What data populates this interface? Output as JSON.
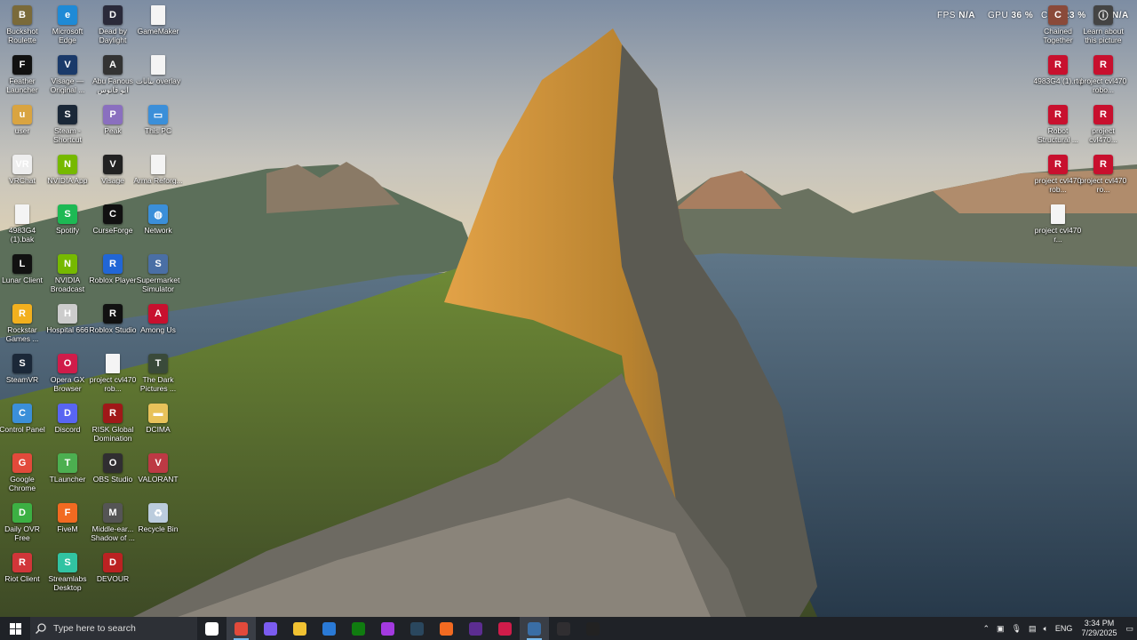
{
  "overlay": {
    "fps_label": "FPS",
    "fps_value": "N/A",
    "gpu_label": "GPU",
    "gpu_value": "36 %",
    "cpu_label": "CPU",
    "cpu_value": "23 %",
    "extra_value": "N/A"
  },
  "desktop_icons_left": [
    {
      "label": "Buckshot Roulette",
      "color": "#7a6a3a",
      "glyph": "B"
    },
    {
      "label": "Microsoft Edge",
      "color": "#1f8ad6",
      "glyph": "e"
    },
    {
      "label": "Dead by Daylight",
      "color": "#2a2a3a",
      "glyph": "D"
    },
    {
      "label": "GameMaker",
      "color": "file",
      "glyph": ""
    },
    {
      "label": "Feather Launcher",
      "color": "#111",
      "glyph": "F"
    },
    {
      "label": "Visage — Original ...",
      "color": "#1a3a6a",
      "glyph": "V"
    },
    {
      "label": "Abu Fanous ابو فانوس",
      "color": "#333",
      "glyph": "A"
    },
    {
      "label": "بيانات overlay",
      "color": "file",
      "glyph": ""
    },
    {
      "label": "user",
      "color": "#d9a441",
      "glyph": "u"
    },
    {
      "label": "Steam - Shortcut",
      "color": "#1b2838",
      "glyph": "S"
    },
    {
      "label": "Peak",
      "color": "#8a6fbf",
      "glyph": "P"
    },
    {
      "label": "This PC",
      "color": "#3b8fd9",
      "glyph": "▭"
    },
    {
      "label": "VRChat",
      "color": "#eee",
      "glyph": "VR"
    },
    {
      "label": "NVIDIA App",
      "color": "#76b900",
      "glyph": "N"
    },
    {
      "label": "Visage",
      "color": "#222",
      "glyph": "V"
    },
    {
      "label": "Arma Reforg...",
      "color": "file",
      "glyph": ""
    },
    {
      "label": "4983G4 (1).bak",
      "color": "file",
      "glyph": ""
    },
    {
      "label": "Spotify",
      "color": "#1db954",
      "glyph": "S"
    },
    {
      "label": "CurseForge",
      "color": "#111",
      "glyph": "C"
    },
    {
      "label": "Network",
      "color": "#3b8fd9",
      "glyph": "◍"
    },
    {
      "label": "Lunar Client",
      "color": "#111",
      "glyph": "L"
    },
    {
      "label": "NVIDIA Broadcast",
      "color": "#76b900",
      "glyph": "N"
    },
    {
      "label": "Roblox Player",
      "color": "#2166d6",
      "glyph": "R"
    },
    {
      "label": "Supermarket Simulator",
      "color": "#4a6fa5",
      "glyph": "S"
    },
    {
      "label": "Rockstar Games ...",
      "color": "#f2b01e",
      "glyph": "R"
    },
    {
      "label": "Hospital 666",
      "color": "#ccc",
      "glyph": "H"
    },
    {
      "label": "Roblox Studio",
      "color": "#111",
      "glyph": "R"
    },
    {
      "label": "Among Us",
      "color": "#c8102e",
      "glyph": "A"
    },
    {
      "label": "SteamVR",
      "color": "#1b2838",
      "glyph": "S"
    },
    {
      "label": "Opera GX Browser",
      "color": "#d01c4a",
      "glyph": "O"
    },
    {
      "label": "project cvl470 rob...",
      "color": "file",
      "glyph": ""
    },
    {
      "label": "The Dark Pictures ...",
      "color": "#3a4a3a",
      "glyph": "T"
    },
    {
      "label": "Control Panel",
      "color": "#3b8fd9",
      "glyph": "C"
    },
    {
      "label": "Discord",
      "color": "#5865f2",
      "glyph": "D"
    },
    {
      "label": "RISK Global Domination",
      "color": "#a01818",
      "glyph": "R"
    },
    {
      "label": "DCIMA",
      "color": "#e8c25a",
      "glyph": "▬"
    },
    {
      "label": "Google Chrome",
      "color": "#e24a3b",
      "glyph": "G"
    },
    {
      "label": "TLauncher",
      "color": "#4caf50",
      "glyph": "T"
    },
    {
      "label": "OBS Studio",
      "color": "#302e31",
      "glyph": "O"
    },
    {
      "label": "VALORANT",
      "color": "#bd3944",
      "glyph": "V"
    },
    {
      "label": "Daily OVR Free",
      "color": "#3cb043",
      "glyph": "D"
    },
    {
      "label": "FiveM",
      "color": "#f26a21",
      "glyph": "F"
    },
    {
      "label": "Middle-ear... Shadow of ...",
      "color": "#555",
      "glyph": "M"
    },
    {
      "label": "Recycle Bin",
      "color": "#bcd",
      "glyph": "♻"
    },
    {
      "label": "Riot Client",
      "color": "#d13639",
      "glyph": "R"
    },
    {
      "label": "Streamlabs Desktop",
      "color": "#31c3a2",
      "glyph": "S"
    },
    {
      "label": "DEVOUR",
      "color": "#b22",
      "glyph": "D"
    }
  ],
  "desktop_icons_right": [
    {
      "label": "Chained Together",
      "color": "#8a4a3a",
      "glyph": "C"
    },
    {
      "label": "Learn about this picture",
      "color": "#444",
      "glyph": "ⓘ"
    },
    {
      "label": "4983G4 (1).rtd",
      "color": "#c8102e",
      "glyph": "R"
    },
    {
      "label": "project cvl470 robo...",
      "color": "#c8102e",
      "glyph": "R"
    },
    {
      "label": "Robot Structural ...",
      "color": "#c8102e",
      "glyph": "R"
    },
    {
      "label": "project cvl470...",
      "color": "#c8102e",
      "glyph": "R"
    },
    {
      "label": "project cvl470 rob...",
      "color": "#c8102e",
      "glyph": "R"
    },
    {
      "label": "project cvl470 ro...",
      "color": "#c8102e",
      "glyph": "R"
    },
    {
      "label": "project cvl470 r...",
      "color": "file",
      "glyph": ""
    }
  ],
  "taskbar": {
    "search_placeholder": "Type here to search",
    "apps": [
      {
        "name": "task-view",
        "color": "#fff",
        "active": false
      },
      {
        "name": "chrome",
        "color": "#e24a3b",
        "active": true
      },
      {
        "name": "copilot",
        "color": "#7b5cf0",
        "active": false
      },
      {
        "name": "file-explorer",
        "color": "#f1c232",
        "active": false
      },
      {
        "name": "microsoft-store",
        "color": "#2a7ad6",
        "active": false
      },
      {
        "name": "xbox",
        "color": "#107c10",
        "active": false
      },
      {
        "name": "messenger",
        "color": "#a33ae0",
        "active": false
      },
      {
        "name": "steam",
        "color": "#2a475e",
        "active": false
      },
      {
        "name": "fivem",
        "color": "#f26a21",
        "active": false
      },
      {
        "name": "visual-studio",
        "color": "#5c2d91",
        "active": false
      },
      {
        "name": "opera-gx",
        "color": "#d01c4a",
        "active": false
      },
      {
        "name": "steam-2",
        "color": "#3a6ea5",
        "active": true
      },
      {
        "name": "obs",
        "color": "#302e31",
        "active": false
      },
      {
        "name": "curseforge",
        "color": "#222",
        "active": false
      }
    ],
    "language": "ENG",
    "time": "3:34 PM",
    "date": "7/29/2025"
  }
}
